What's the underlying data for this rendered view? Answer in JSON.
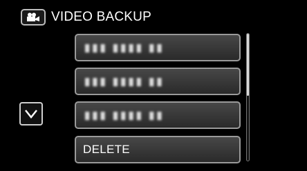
{
  "header": {
    "title": "VIDEO BACKUP",
    "icon": "video-camera-icon"
  },
  "menu": {
    "items": [
      {
        "label": "",
        "masked": "▮▮▮ ▮▮▮▮ ▮▮"
      },
      {
        "label": "",
        "masked": "▮▮▮ ▮▮▮▮ ▮▮"
      },
      {
        "label": "",
        "masked": "▮▮▮ ▮▮▮▮ ▮▮"
      },
      {
        "label": "DELETE"
      }
    ]
  },
  "controls": {
    "scroll_down_icon": "chevron-down-icon"
  }
}
